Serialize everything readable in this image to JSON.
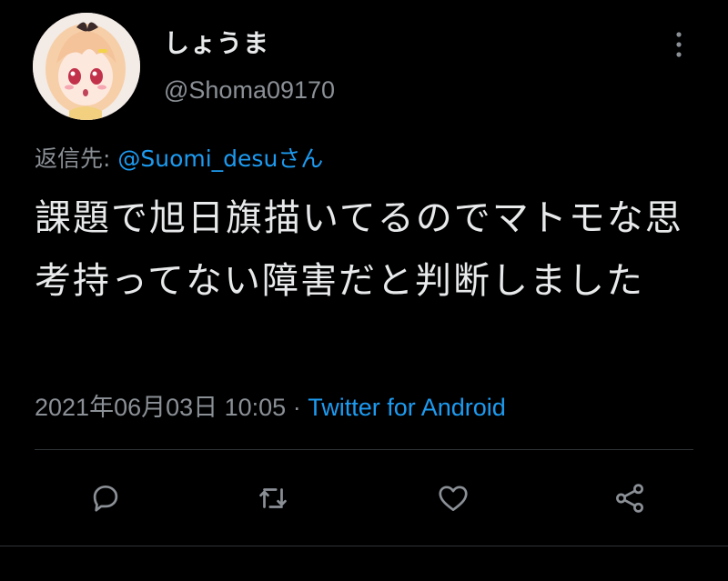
{
  "tweet": {
    "display_name": "しょうま",
    "handle": "@Shoma09170",
    "reply_prefix": "返信先: ",
    "reply_to": "@Suomi_desuさん",
    "text": "課題で旭日旗描いてるのでマトモな思考持ってない障害だと判断しました",
    "timestamp": "2021年06月03日 10:05",
    "separator": " · ",
    "source": "Twitter for Android"
  },
  "icons": {
    "more": "more-vertical-icon",
    "reply": "reply-bubble-icon",
    "retweet": "retweet-icon",
    "like": "heart-icon",
    "share": "share-icon"
  },
  "colors": {
    "background": "#000000",
    "text": "#e7e9ea",
    "secondary": "#8b9096",
    "link": "#1d9bf0"
  }
}
